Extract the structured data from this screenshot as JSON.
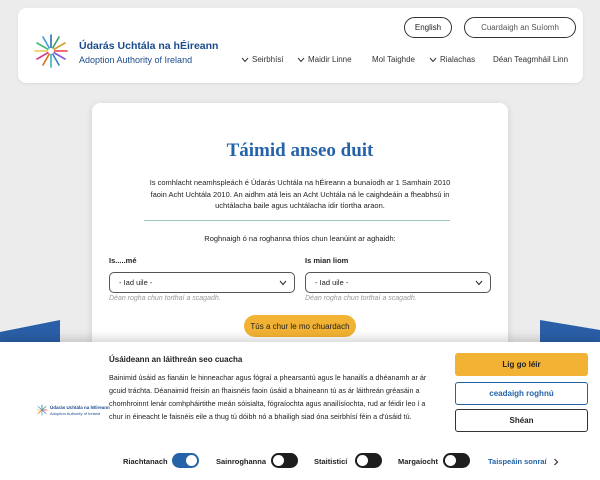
{
  "header": {
    "logo_title": "Údarás Uchtála na hÉireann",
    "logo_subtitle": "Adoption Authority of Ireland",
    "lang_button": "English",
    "search_placeholder": "Cuardaigh an Suíomh",
    "nav": [
      "Seirbhísí",
      "Maidir Linne",
      "Mol Taighde",
      "Rialachas",
      "Déan Teagmháil Linn"
    ]
  },
  "main": {
    "title": "Táimid anseo duit",
    "description": "Is comhlacht neamhspleách é Údarás Uchtála na hÉireann a bunaíodh ar 1 Samhain 2010 faoin Acht Uchtála 2010. An aidhm atá leis an Acht Uchtála ná le caighdeáin a fheabhsú in uchtálacha baile agus uchtálacha idir tíortha araon.",
    "prompt": "Roghnaigh ó na roghanna thíos chun leanúint ar aghaidh:",
    "field1_label": "Is.....mé",
    "field1_value": "- Iad uile -",
    "field1_hint": "Déan rogha chun torthaí a scagadh.",
    "field2_label": "Is mian liom",
    "field2_value": "- Iad uile -",
    "field2_hint": "Déan rogha chun torthaí a scagadh.",
    "cta": "Tús a chur le mo chuardach"
  },
  "cookie": {
    "logo_title": "Údarás Uchtála na hÉireann",
    "logo_subtitle": "Adoption Authority of Ireland",
    "title": "Úsáideann an láithreán seo cuacha",
    "text": "Bainimid úsáid as fianáin le hinneachar agus fógraí a phearsantú agus le hanailís a dhéanamh ar ár gcuid tráchta. Déanaimid freisin an fhaisnéis faoin úsáid a bhaineann tú as ár láithreán gréasáin a chomhroinnt lenár comhpháirtithe meán sóisialta, fógraíochta agus anailísíochta, rud ar féidir leo í a chur in éineacht le faisnéis eile a thug tú dóibh nó a bhailigh siad óna seirbhísí féin a d'úsáid tú.",
    "accept": "Lig go léir",
    "customize": "ceadaigh roghnú",
    "reject": "Shéan",
    "toggles": [
      {
        "label": "Riachtanach",
        "state": "on"
      },
      {
        "label": "Sainroghanna",
        "state": "off"
      },
      {
        "label": "Staitisticí",
        "state": "off"
      },
      {
        "label": "Margaíocht",
        "state": "off"
      }
    ],
    "details_link": "Taispeáin sonraí"
  },
  "colors": {
    "brand_blue": "#2563a8",
    "accent_yellow": "#f2b233",
    "logo_navy": "#1a4b8c"
  }
}
